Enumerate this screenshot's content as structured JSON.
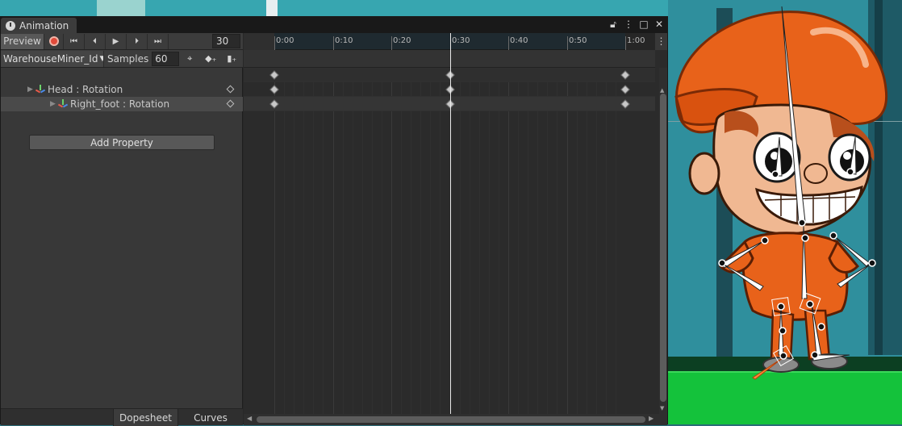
{
  "window": {
    "tab_title": "Animation",
    "title_buttons": [
      "lock-icon",
      "kebab-menu-icon",
      "maximize-icon",
      "close-icon"
    ]
  },
  "toolbar": {
    "preview_label": "Preview",
    "frame_value": "30",
    "clip_name": "WarehouseMiner_Id",
    "samples_label": "Samples",
    "samples_value": "60"
  },
  "properties": [
    {
      "label": "Head : Rotation",
      "selected": false
    },
    {
      "label": "Right_foot : Rotation",
      "selected": true
    }
  ],
  "add_property_label": "Add Property",
  "bottom_tabs": {
    "dopesheet": "Dopesheet",
    "curves": "Curves"
  },
  "ruler": {
    "labels": [
      "0:00",
      "0:10",
      "0:20",
      "0:30",
      "0:40",
      "0:50",
      "1:00"
    ]
  },
  "playhead_frame": "0:30",
  "keyframes_at": [
    "0:00",
    "0:30",
    "1:00"
  ],
  "colors": {
    "record": "#e24a3a",
    "character_orange": "#e8621a",
    "floor_green": "#14c23b"
  }
}
